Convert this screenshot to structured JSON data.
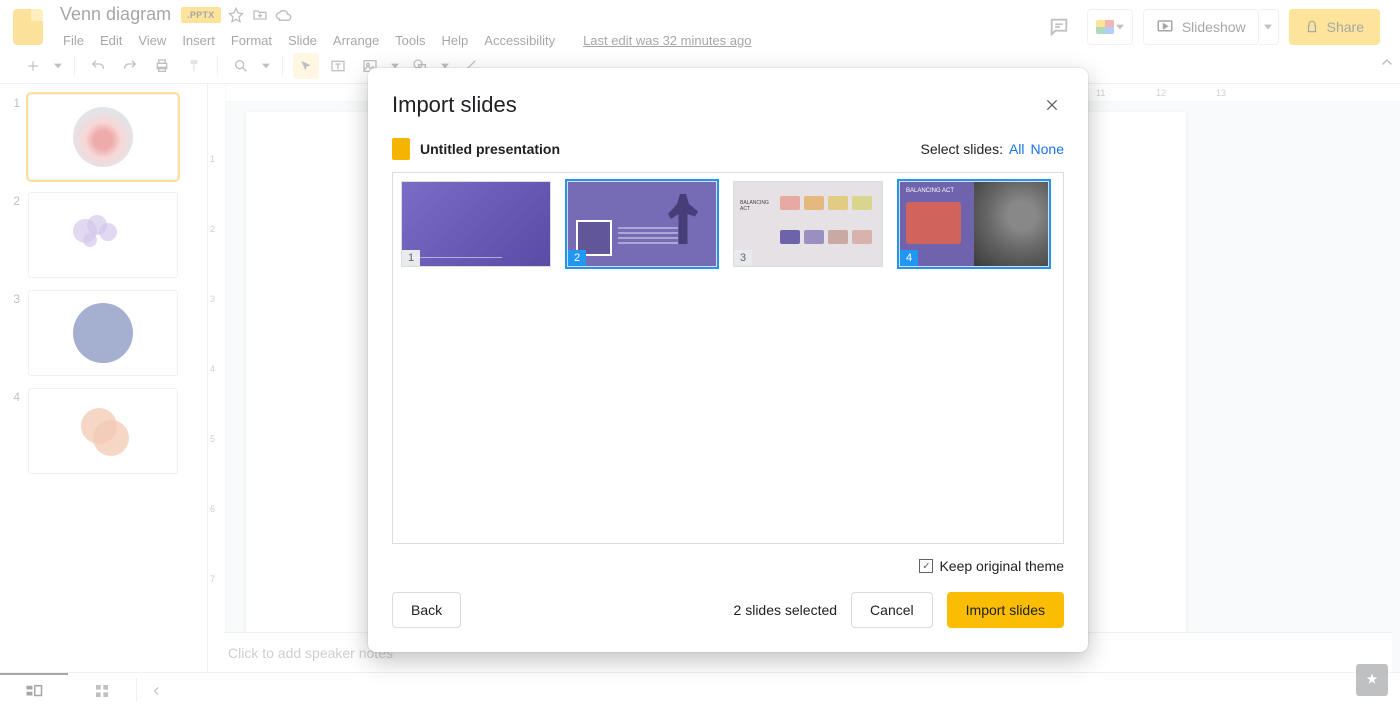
{
  "header": {
    "doc_title": "Venn diagram",
    "file_badge": ".PPTX",
    "last_edit": "Last edit was 32 minutes ago",
    "menus": [
      "File",
      "Edit",
      "View",
      "Insert",
      "Format",
      "Slide",
      "Arrange",
      "Tools",
      "Help",
      "Accessibility"
    ],
    "slideshow_label": "Slideshow",
    "share_label": "Share"
  },
  "ruler": {
    "h_ticks": [
      "11",
      "12",
      "13"
    ],
    "v_ticks": [
      "1",
      "2",
      "3",
      "4",
      "5",
      "6",
      "7"
    ]
  },
  "filmstrip": {
    "slides": [
      {
        "num": "1"
      },
      {
        "num": "2"
      },
      {
        "num": "3"
      },
      {
        "num": "4"
      }
    ]
  },
  "notes_placeholder": "Click to add speaker notes",
  "modal": {
    "title": "Import slides",
    "presentation_name": "Untitled presentation",
    "select_label": "Select slides:",
    "select_all": "All",
    "select_none": "None",
    "thumbs": [
      {
        "num": "1",
        "selected": false
      },
      {
        "num": "2",
        "selected": true
      },
      {
        "num": "3",
        "selected": false
      },
      {
        "num": "4",
        "selected": true
      }
    ],
    "keep_theme_label": "Keep original theme",
    "keep_theme_checked": true,
    "back_label": "Back",
    "selected_count_label": "2 slides selected",
    "cancel_label": "Cancel",
    "import_label": "Import slides"
  }
}
